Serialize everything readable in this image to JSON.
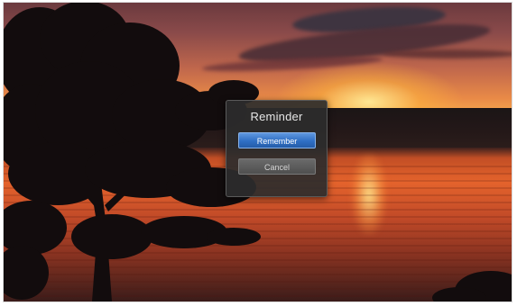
{
  "dialog": {
    "title": "Reminder",
    "primary_button": "Remember",
    "secondary_button": "Cancel"
  },
  "colors": {
    "primary_button": "#2f6fc4",
    "secondary_button": "#4f4f4f",
    "dialog_background": "#2d2d2d"
  }
}
